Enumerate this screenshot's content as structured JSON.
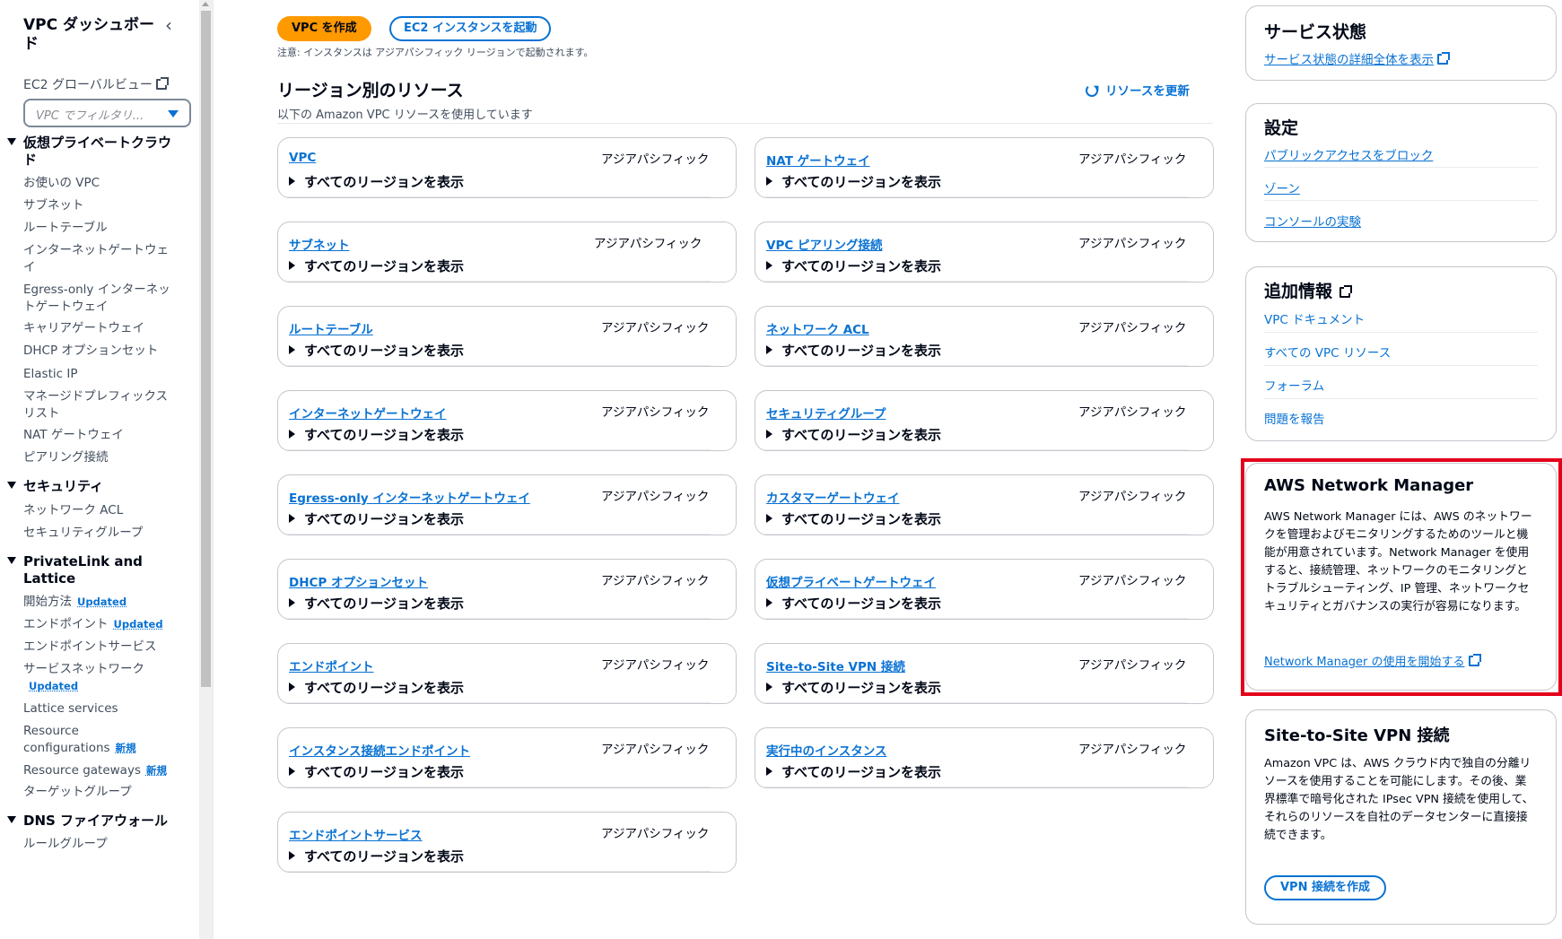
{
  "sidebar": {
    "title": "VPC ダッシュボード",
    "global_view": "EC2 グローバルビュー",
    "filter_placeholder": "VPC でフィルタリ...",
    "sections": [
      {
        "label": "仮想プライベートクラウド",
        "items": [
          "お使いの VPC",
          "サブネット",
          "ルートテーブル",
          "インターネットゲートウェイ",
          "Egress-only インターネットゲートウェイ",
          "キャリアゲートウェイ",
          "DHCP オプションセット",
          "Elastic IP",
          "マネージドプレフィックスリスト",
          "NAT ゲートウェイ",
          "ピアリング接続"
        ]
      },
      {
        "label": "セキュリティ",
        "items": [
          "ネットワーク ACL",
          "セキュリティグループ"
        ]
      },
      {
        "label": "PrivateLink and Lattice",
        "items": [
          "開始方法",
          "エンドポイント",
          "エンドポイントサービス",
          "サービスネットワーク",
          "Lattice services",
          "Resource configurations",
          "Resource gateways",
          "ターゲットグループ"
        ]
      },
      {
        "label": "DNS ファイアウォール",
        "items": [
          "ルールグループ"
        ]
      }
    ],
    "badges": {
      "updated": "Updated",
      "new": "新規"
    }
  },
  "main": {
    "create_vpc": "VPC を作成",
    "launch_ec2": "EC2 インスタンスを起動",
    "note": "注意: インスタンスは アジアパシフィック リージョンで起動されます。",
    "resources_title": "リージョン別のリソース",
    "resources_subtitle": "以下の Amazon VPC リソースを使用しています",
    "refresh": "リソースを更新",
    "region": "アジアパシフィック",
    "expand_label": "すべてのリージョンを表示",
    "left_cards": [
      "VPC",
      "サブネット",
      "ルートテーブル",
      "インターネットゲートウェイ",
      "Egress-only インターネットゲートウェイ",
      "DHCP オプションセット",
      "エンドポイント",
      "インスタンス接続エンドポイント",
      "エンドポイントサービス"
    ],
    "right_cards": [
      "NAT ゲートウェイ",
      "VPC ピアリング接続",
      "ネットワーク ACL",
      "セキュリティグループ",
      "カスタマーゲートウェイ",
      "仮想プライベートゲートウェイ",
      "Site-to-Site VPN 接続",
      "実行中のインスタンス"
    ]
  },
  "right": {
    "service_health": {
      "title": "サービス状態",
      "link": "サービス状態の詳細全体を表示"
    },
    "settings": {
      "title": "設定",
      "links": [
        "パブリックアクセスをブロック",
        "ゾーン",
        "コンソールの実験"
      ]
    },
    "additional_info": {
      "title": "追加情報",
      "links": [
        "VPC ドキュメント",
        "すべての VPC リソース",
        "フォーラム",
        "問題を報告"
      ]
    },
    "network_manager": {
      "title": "AWS Network Manager",
      "body": "AWS Network Manager には、AWS のネットワークを管理およびモニタリングするためのツールと機能が用意されています。Network Manager を使用すると、接続管理、ネットワークのモニタリングとトラブルシューティング、IP 管理、ネットワークセキュリティとガバナンスの実行が容易になります。",
      "link": "Network Manager の使用を開始する"
    },
    "vpn": {
      "title": "Site-to-Site VPN 接続",
      "body": "Amazon VPC は、AWS クラウド内で独自の分離リソースを使用することを可能にします。その後、業界標準で暗号化された IPsec VPN 接続を使用して、それらのリソースを自社のデータセンターに直接接続できます。",
      "button": "VPN 接続を作成"
    }
  },
  "colors": {
    "accent": "#0972d3",
    "primary_button": "#ff9900",
    "highlight_border": "#e3001b"
  }
}
